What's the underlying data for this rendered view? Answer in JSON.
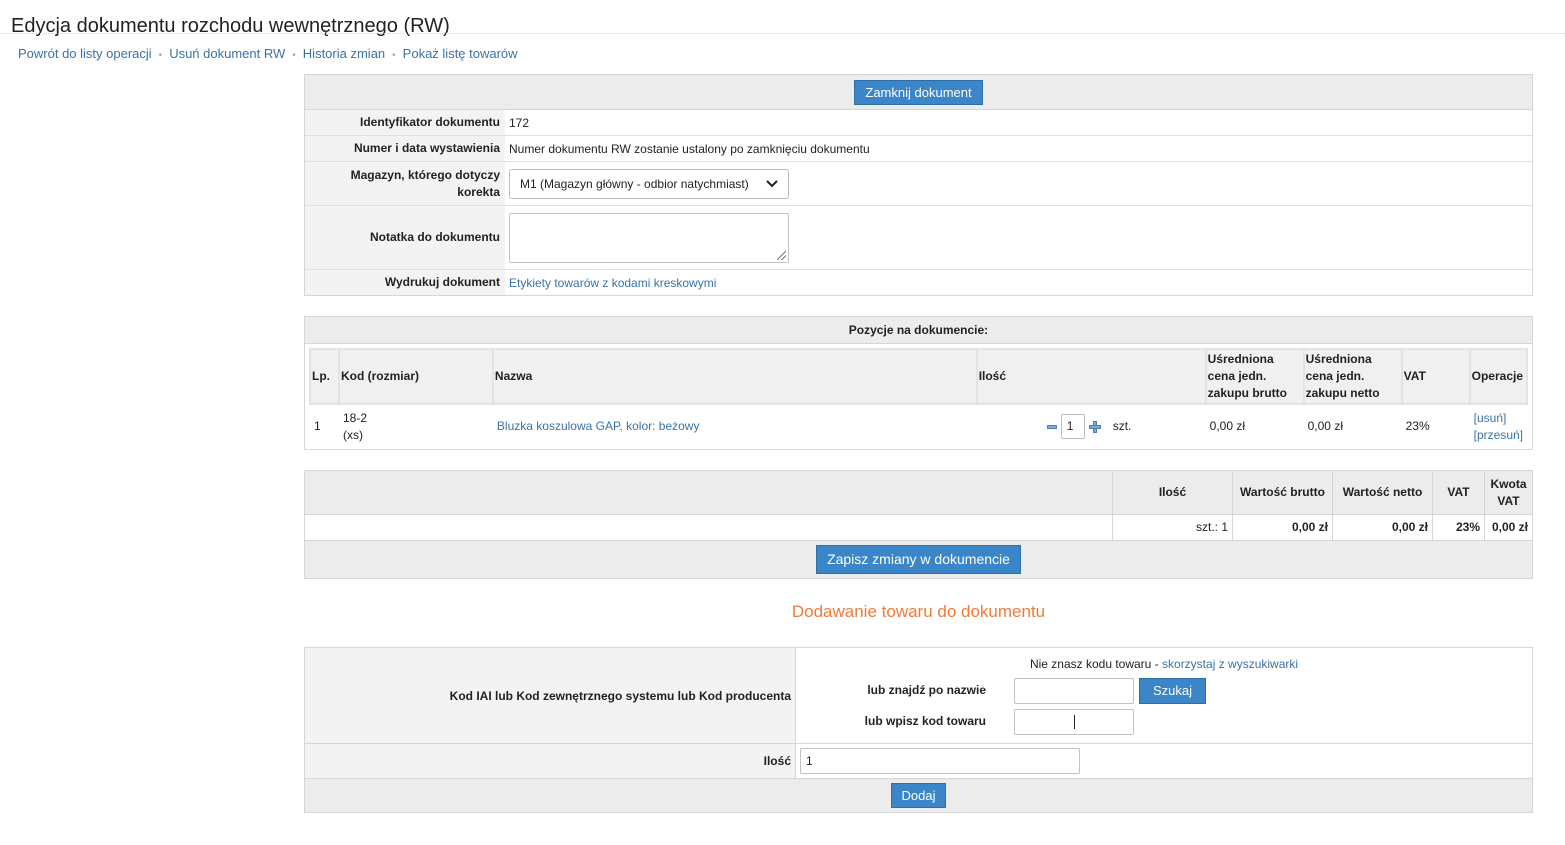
{
  "page": {
    "title": "Edycja dokumentu rozchodu wewnętrznego (RW)"
  },
  "nav": [
    "Powrót do listy operacji",
    "Usuń dokument RW",
    "Historia zmian",
    "Pokaż listę towarów"
  ],
  "doc_form": {
    "close_button": "Zamknij dokument",
    "id_label": "Identyfikator dokumentu",
    "id_value": "172",
    "number_label": "Numer i data wystawienia",
    "number_value": "Numer dokumentu RW zostanie ustalony po zamknięciu dokumentu",
    "warehouse_label": "Magazyn, którego dotyczy korekta",
    "warehouse_selected": "M1 (Magazyn główny - odbior natychmiast)",
    "note_label": "Notatka do dokumentu",
    "note_value": "",
    "print_label": "Wydrukuj dokument",
    "print_link": "Etykiety towarów z kodami kreskowymi"
  },
  "items": {
    "title": "Pozycje na dokumencie:",
    "headers": {
      "lp": "Lp.",
      "code": "Kod (rozmiar)",
      "name": "Nazwa",
      "qty": "Ilość",
      "avg_gross": "Uśredniona cena jedn. zakupu brutto",
      "avg_net": "Uśredniona cena jedn. zakupu netto",
      "vat": "VAT",
      "ops": "Operacje"
    },
    "rows": [
      {
        "lp": "1",
        "code": "18-2",
        "size": "(xs)",
        "name": "Bluzka koszulowa GAP, kolor: beżowy",
        "qty": "1",
        "unit": "szt.",
        "avg_gross": "0,00 zł",
        "avg_net": "0,00 zł",
        "vat": "23%",
        "op_delete": "[usuń]",
        "op_move": "[przesuń]"
      }
    ]
  },
  "totals": {
    "headers": {
      "qty": "Ilość",
      "gross": "Wartość brutto",
      "net": "Wartość netto",
      "vat": "VAT",
      "vat_amount": "Kwota VAT"
    },
    "qty": "szt.: 1",
    "gross": "0,00 zł",
    "net": "0,00 zł",
    "vat": "23%",
    "vat_amount": "0,00 zł",
    "save_button": "Zapisz zmiany w dokumencie"
  },
  "add_product": {
    "section_title": "Dodawanie towaru do dokumentu",
    "code_label": "Kod IAI lub Kod zewnętrznego systemu lub Kod producenta",
    "hint_text": "Nie znasz kodu towaru - ",
    "hint_link": "skorzystaj z wyszukiwarki",
    "find_label": "lub znajdź po nazwie",
    "search_button": "Szukaj",
    "code_input_label": "lub wpisz kod towaru",
    "qty_label": "Ilość",
    "qty_value": "1",
    "add_button": "Dodaj"
  }
}
